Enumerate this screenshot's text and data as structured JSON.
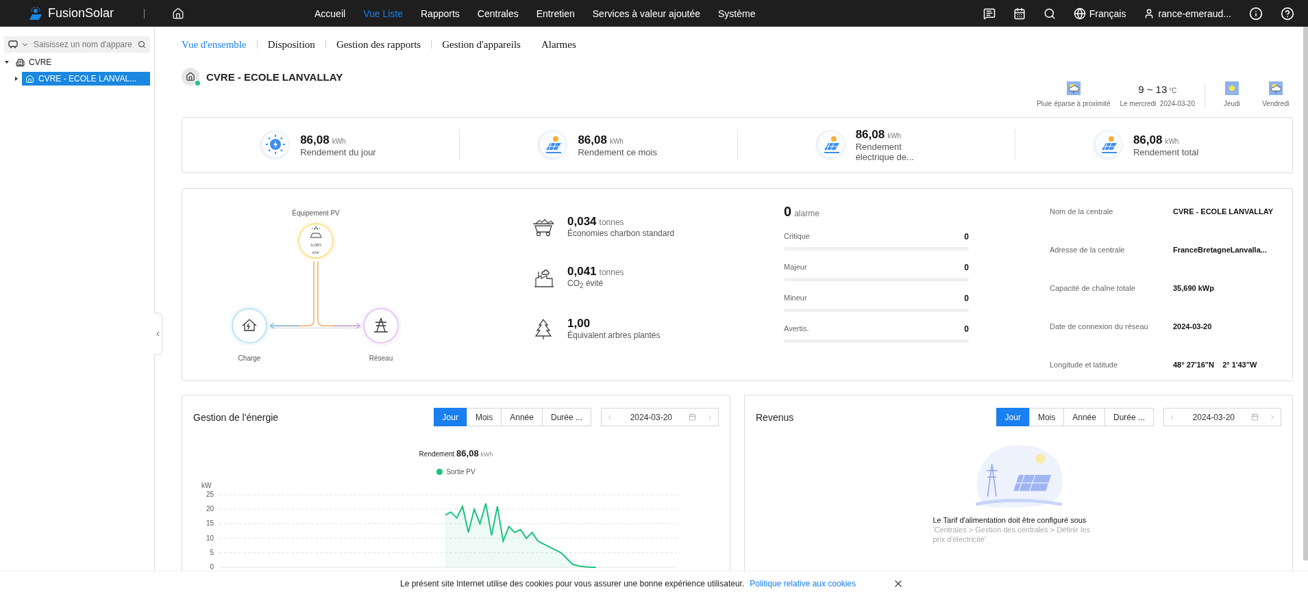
{
  "topbar": {
    "brand": "FusionSolar",
    "nav": [
      {
        "label": "Accueil",
        "selected": false
      },
      {
        "label": "Vue Liste",
        "selected": true
      },
      {
        "label": "Rapports",
        "selected": false
      },
      {
        "label": "Centrales",
        "selected": false
      },
      {
        "label": "Entretien",
        "selected": false
      },
      {
        "label": "Services à valeur ajoutée",
        "selected": false
      },
      {
        "label": "Système",
        "selected": false
      }
    ],
    "language": "Français",
    "user": "rance-emeraud..."
  },
  "sidebar": {
    "search": {
      "placeholder": "Saisissez un nom d'appare"
    },
    "tree": [
      {
        "label": "CVRE",
        "expanded": true,
        "children": [
          {
            "label": "CVRE - ECOLE LANVAL...",
            "selected": true,
            "expanded": false
          }
        ]
      }
    ]
  },
  "tabs": [
    {
      "label": "Vue d'ensemble",
      "selected": true
    },
    {
      "label": "Disposition",
      "selected": false
    },
    {
      "label": "Gestion des rapports",
      "selected": false
    },
    {
      "label": "Gestion d'appareils",
      "selected": false
    },
    {
      "label": "Alarmes",
      "selected": false
    }
  ],
  "station": {
    "name": "CVRE - ECOLE LANVALLAY",
    "online": true
  },
  "weather": {
    "today": {
      "kind": "rain",
      "label": "Pluie éparse à proximité"
    },
    "temperature": "9 ~ 13",
    "unit": "°C",
    "day": "Le mercredi",
    "date": "2024-03-20",
    "forecast": [
      {
        "kind": "sun",
        "label": "Jeudi"
      },
      {
        "kind": "rain",
        "label": "Vendredi"
      }
    ]
  },
  "yields": [
    {
      "kind": "day",
      "value": "86,08",
      "unit": "kWh",
      "label": "Rendement du jour"
    },
    {
      "kind": "panel",
      "value": "86,08",
      "unit": "kWh",
      "label": "Rendement ce mois"
    },
    {
      "kind": "panel",
      "value": "86,08",
      "unit": "kWh",
      "label": "Rendement électrique de..."
    },
    {
      "kind": "panel",
      "value": "86,08",
      "unit": "kWh",
      "label": "Rendement total"
    }
  ],
  "flow": {
    "pv": {
      "label": "Équipement PV",
      "value": "0,085",
      "unit": "kW"
    },
    "load": {
      "label": "Charge"
    },
    "grid": {
      "label": "Réseau"
    }
  },
  "environment": [
    {
      "kind": "coal",
      "value": "0,034",
      "unit": "tonnes",
      "label": "Économies charbon standard"
    },
    {
      "kind": "co2",
      "value": "0,041",
      "unit": "tonnes",
      "label": "CO$_{2}$ évité"
    },
    {
      "kind": "tree",
      "value": "1,00",
      "label": "Équivalent arbres plantés"
    }
  ],
  "alarms": {
    "count": "0",
    "unit": "alarme",
    "levels": [
      {
        "label": "Critique",
        "count": "0",
        "level": 0
      },
      {
        "label": "Majeur",
        "count": "0",
        "level": 0
      },
      {
        "label": "Mineur",
        "count": "0",
        "level": 0
      },
      {
        "label": "Avertis.",
        "count": "0",
        "level": 0
      }
    ]
  },
  "info": [
    {
      "label": "Nom de la centrale",
      "value": "CVRE - ECOLE LANVALLAY"
    },
    {
      "label": "Adresse de la centrale",
      "value": "FranceBretagneLanvalla..."
    },
    {
      "label": "Capacité de chaîne totale",
      "value": "35,690 kWp"
    },
    {
      "label": "Date de connexion du réseau",
      "value": "2024-03-20"
    },
    {
      "label": "Longitude et latitude",
      "value": "48° 27'16\"N    2° 1'43\"W"
    }
  ],
  "energy": {
    "title": "Gestion de l'énergie",
    "periods": [
      {
        "label": "Jour",
        "selected": true
      },
      {
        "label": "Mois",
        "selected": false
      },
      {
        "label": "Année",
        "selected": false
      },
      {
        "label": "Durée ...",
        "selected": false
      }
    ],
    "date": "2024-03-20",
    "yield_label": "Rendement",
    "yield_value": "86,08",
    "yield_unit": "kWh",
    "chart_data": {
      "type": "line",
      "grid": true,
      "ylabel": "kW",
      "ylim": [
        0,
        25
      ],
      "yticks": [
        0,
        5,
        10,
        15,
        20,
        25
      ],
      "series": [
        {
          "name": "Sortie PV",
          "color": "#19c37d",
          "values": [
            null,
            null,
            null,
            null,
            null,
            null,
            null,
            null,
            null,
            null,
            null,
            null,
            null,
            null,
            null,
            null,
            null,
            null,
            null,
            null,
            null,
            null,
            null,
            null,
            null,
            null,
            null,
            null,
            null,
            null,
            null,
            null,
            null,
            null,
            null,
            null,
            null,
            null,
            null,
            18,
            19,
            17,
            21,
            12,
            20,
            15,
            22,
            11,
            21,
            9,
            14,
            12,
            13,
            10,
            12,
            9,
            8,
            7,
            6,
            5,
            3,
            1,
            0.5,
            0.2,
            0,
            0,
            null,
            null,
            null,
            null,
            null,
            null,
            null,
            null,
            null,
            null,
            null,
            null,
            null,
            null
          ]
        }
      ]
    }
  },
  "revenue": {
    "title": "Revenus",
    "periods": [
      {
        "label": "Jour",
        "selected": true
      },
      {
        "label": "Mois",
        "selected": false
      },
      {
        "label": "Année",
        "selected": false
      },
      {
        "label": "Durée ...",
        "selected": false
      }
    ],
    "date": "2024-03-20",
    "message": "Le Tarif d'alimentation doit être configuré sous",
    "path": "'Centrales > Gestion des centrales > Définir les prix d'électricité'"
  },
  "cookie": {
    "text": "Le présent site Internet utilise des cookies pour vous assurer une bonne expérience utilisateur.",
    "link": "Politique relative aux cookies"
  }
}
